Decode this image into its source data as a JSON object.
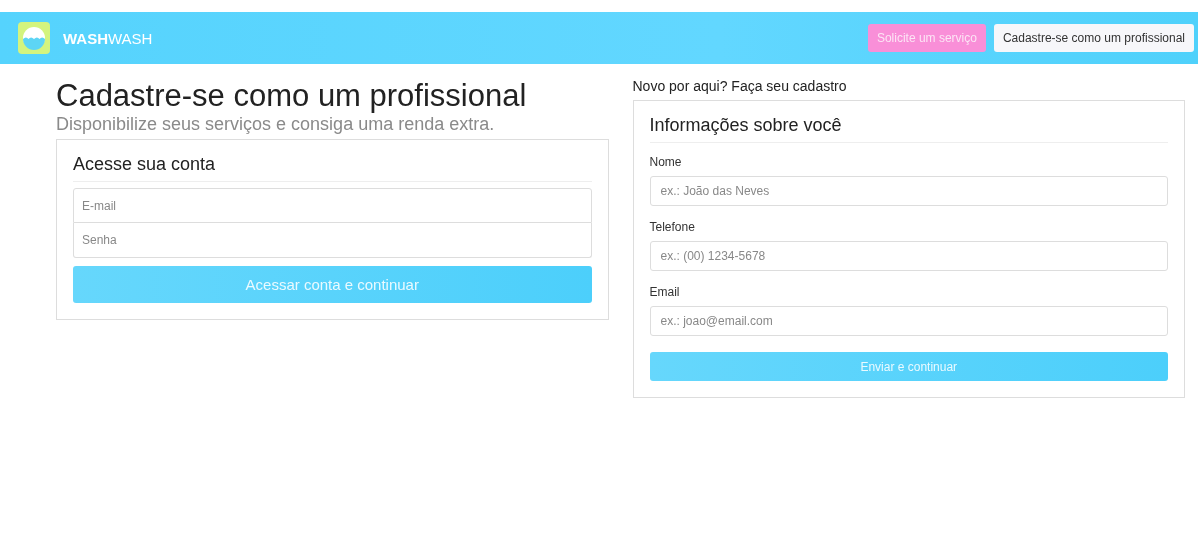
{
  "navbar": {
    "brand": "**WASH**WASH",
    "buttons": [
      {
        "label": "Solicite um serviço",
        "kind": "pink"
      },
      {
        "label": "Cadastre-se como um profissional",
        "kind": "light"
      }
    ]
  },
  "hero": {
    "title": "Cadastre-se como um profissional",
    "subtitle": "Disponibilize seus serviços e consiga uma renda extra."
  },
  "login": {
    "title": "Acesse sua conta",
    "fields": [
      {
        "placeholder": "E-mail"
      },
      {
        "placeholder": "Senha"
      }
    ],
    "button": "Acessar conta e continuar"
  },
  "signup": {
    "intro": "Novo por aqui? Faça seu cadastro",
    "title": "Informações sobre você",
    "fields": [
      {
        "label": "Nome",
        "placeholder": "ex.: João das Neves"
      },
      {
        "label": "Telefone",
        "placeholder": "ex.: (00) 1234-5678"
      },
      {
        "label": "Email",
        "placeholder": "ex.: joao@email.com"
      }
    ],
    "button": "Enviar e continuar"
  }
}
